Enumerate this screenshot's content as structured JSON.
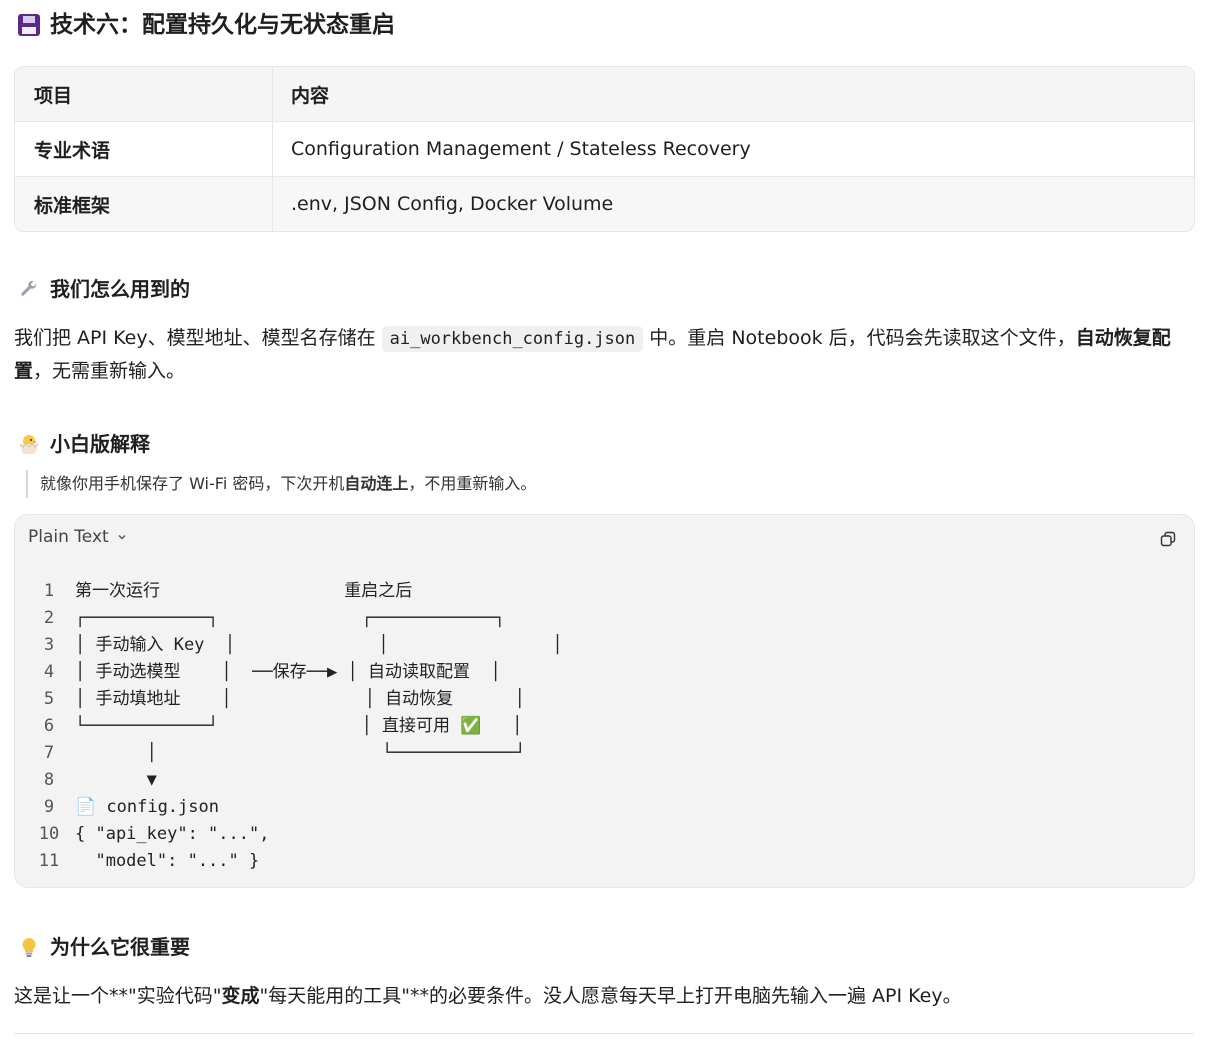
{
  "section": {
    "title": "技术六：配置持久化与无状态重启",
    "icon": "floppy-disk-icon"
  },
  "meta_table": {
    "header": [
      "项目",
      "内容"
    ],
    "rows": [
      [
        "专业术语",
        "Configuration Management / Stateless Recovery"
      ],
      [
        "标准框架",
        ".env, JSON Config, Docker Volume"
      ]
    ]
  },
  "how_we_use": {
    "title": "我们怎么用到的",
    "icon": "wrench-icon",
    "text_before": "我们把 API Key、模型地址、模型名存储在 ",
    "code": "ai_workbench_config.json",
    "text_middle": " 中。重启 Notebook 后，代码会先读取这个文件，",
    "bold": "自动恢复配置",
    "text_after": "，无需重新输入。"
  },
  "beginner": {
    "title": "小白版解释",
    "icon": "hatching-chick-icon",
    "quote_before": "就像你用手机保存了 Wi-Fi 密码，下次开机",
    "quote_bold": "自动连上",
    "quote_after": "，不用重新输入。"
  },
  "code_block": {
    "language": "Plain Text",
    "copy_icon": "copy-icon",
    "lines": [
      {
        "n": "1",
        "text": "第一次运行                  重启之后"
      },
      {
        "n": "2",
        "text": "┌────────────┐              ┌────────────┐"
      },
      {
        "n": "3",
        "text": "│ 手动输入 Key  │              │                │"
      },
      {
        "n": "4",
        "text": "│ 手动选模型    │  ──保存──▶ │ 自动读取配置  │"
      },
      {
        "n": "5",
        "text": "│ 手动填地址    │             │ 自动恢复      │"
      },
      {
        "n": "6",
        "text": "└────────────┘              │ 直接可用 ✅   │"
      },
      {
        "n": "7",
        "text": "       │                      └────────────┘"
      },
      {
        "n": "8",
        "text": "       ▼"
      },
      {
        "n": "9",
        "text": "📄 config.json"
      },
      {
        "n": "10",
        "text": "{ \"api_key\": \"...\","
      },
      {
        "n": "11",
        "text": "  \"model\": \"...\" }"
      }
    ]
  },
  "why": {
    "title": "为什么它很重要",
    "icon": "light-bulb-icon",
    "text_before": "这是让一个**\"实验代码\"",
    "bold": "变成",
    "text_after": "\"每天能用的工具\"**的必要条件。没人愿意每天早上打开电脑先输入一遍 API Key。"
  }
}
